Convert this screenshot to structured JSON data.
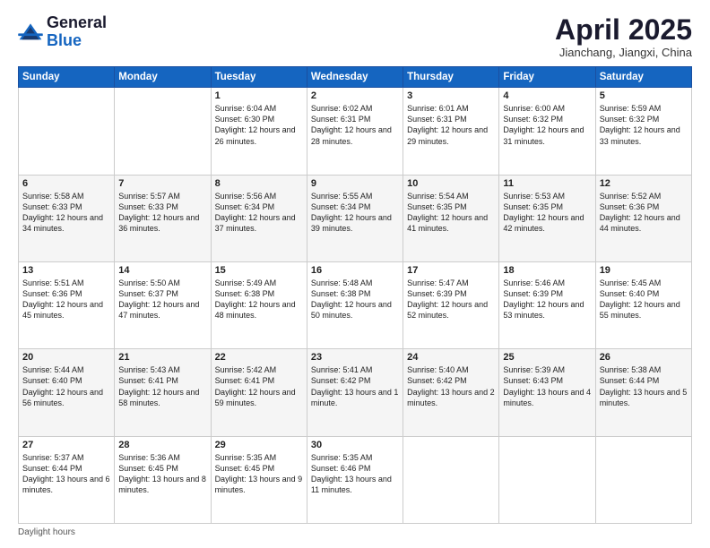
{
  "header": {
    "logo_general": "General",
    "logo_blue": "Blue",
    "month_title": "April 2025",
    "subtitle": "Jianchang, Jiangxi, China"
  },
  "columns": [
    "Sunday",
    "Monday",
    "Tuesday",
    "Wednesday",
    "Thursday",
    "Friday",
    "Saturday"
  ],
  "weeks": [
    [
      {
        "day": "",
        "info": ""
      },
      {
        "day": "",
        "info": ""
      },
      {
        "day": "1",
        "info": "Sunrise: 6:04 AM\nSunset: 6:30 PM\nDaylight: 12 hours and 26 minutes."
      },
      {
        "day": "2",
        "info": "Sunrise: 6:02 AM\nSunset: 6:31 PM\nDaylight: 12 hours and 28 minutes."
      },
      {
        "day": "3",
        "info": "Sunrise: 6:01 AM\nSunset: 6:31 PM\nDaylight: 12 hours and 29 minutes."
      },
      {
        "day": "4",
        "info": "Sunrise: 6:00 AM\nSunset: 6:32 PM\nDaylight: 12 hours and 31 minutes."
      },
      {
        "day": "5",
        "info": "Sunrise: 5:59 AM\nSunset: 6:32 PM\nDaylight: 12 hours and 33 minutes."
      }
    ],
    [
      {
        "day": "6",
        "info": "Sunrise: 5:58 AM\nSunset: 6:33 PM\nDaylight: 12 hours and 34 minutes."
      },
      {
        "day": "7",
        "info": "Sunrise: 5:57 AM\nSunset: 6:33 PM\nDaylight: 12 hours and 36 minutes."
      },
      {
        "day": "8",
        "info": "Sunrise: 5:56 AM\nSunset: 6:34 PM\nDaylight: 12 hours and 37 minutes."
      },
      {
        "day": "9",
        "info": "Sunrise: 5:55 AM\nSunset: 6:34 PM\nDaylight: 12 hours and 39 minutes."
      },
      {
        "day": "10",
        "info": "Sunrise: 5:54 AM\nSunset: 6:35 PM\nDaylight: 12 hours and 41 minutes."
      },
      {
        "day": "11",
        "info": "Sunrise: 5:53 AM\nSunset: 6:35 PM\nDaylight: 12 hours and 42 minutes."
      },
      {
        "day": "12",
        "info": "Sunrise: 5:52 AM\nSunset: 6:36 PM\nDaylight: 12 hours and 44 minutes."
      }
    ],
    [
      {
        "day": "13",
        "info": "Sunrise: 5:51 AM\nSunset: 6:36 PM\nDaylight: 12 hours and 45 minutes."
      },
      {
        "day": "14",
        "info": "Sunrise: 5:50 AM\nSunset: 6:37 PM\nDaylight: 12 hours and 47 minutes."
      },
      {
        "day": "15",
        "info": "Sunrise: 5:49 AM\nSunset: 6:38 PM\nDaylight: 12 hours and 48 minutes."
      },
      {
        "day": "16",
        "info": "Sunrise: 5:48 AM\nSunset: 6:38 PM\nDaylight: 12 hours and 50 minutes."
      },
      {
        "day": "17",
        "info": "Sunrise: 5:47 AM\nSunset: 6:39 PM\nDaylight: 12 hours and 52 minutes."
      },
      {
        "day": "18",
        "info": "Sunrise: 5:46 AM\nSunset: 6:39 PM\nDaylight: 12 hours and 53 minutes."
      },
      {
        "day": "19",
        "info": "Sunrise: 5:45 AM\nSunset: 6:40 PM\nDaylight: 12 hours and 55 minutes."
      }
    ],
    [
      {
        "day": "20",
        "info": "Sunrise: 5:44 AM\nSunset: 6:40 PM\nDaylight: 12 hours and 56 minutes."
      },
      {
        "day": "21",
        "info": "Sunrise: 5:43 AM\nSunset: 6:41 PM\nDaylight: 12 hours and 58 minutes."
      },
      {
        "day": "22",
        "info": "Sunrise: 5:42 AM\nSunset: 6:41 PM\nDaylight: 12 hours and 59 minutes."
      },
      {
        "day": "23",
        "info": "Sunrise: 5:41 AM\nSunset: 6:42 PM\nDaylight: 13 hours and 1 minute."
      },
      {
        "day": "24",
        "info": "Sunrise: 5:40 AM\nSunset: 6:42 PM\nDaylight: 13 hours and 2 minutes."
      },
      {
        "day": "25",
        "info": "Sunrise: 5:39 AM\nSunset: 6:43 PM\nDaylight: 13 hours and 4 minutes."
      },
      {
        "day": "26",
        "info": "Sunrise: 5:38 AM\nSunset: 6:44 PM\nDaylight: 13 hours and 5 minutes."
      }
    ],
    [
      {
        "day": "27",
        "info": "Sunrise: 5:37 AM\nSunset: 6:44 PM\nDaylight: 13 hours and 6 minutes."
      },
      {
        "day": "28",
        "info": "Sunrise: 5:36 AM\nSunset: 6:45 PM\nDaylight: 13 hours and 8 minutes."
      },
      {
        "day": "29",
        "info": "Sunrise: 5:35 AM\nSunset: 6:45 PM\nDaylight: 13 hours and 9 minutes."
      },
      {
        "day": "30",
        "info": "Sunrise: 5:35 AM\nSunset: 6:46 PM\nDaylight: 13 hours and 11 minutes."
      },
      {
        "day": "",
        "info": ""
      },
      {
        "day": "",
        "info": ""
      },
      {
        "day": "",
        "info": ""
      }
    ]
  ],
  "footer": {
    "note": "Daylight hours"
  }
}
